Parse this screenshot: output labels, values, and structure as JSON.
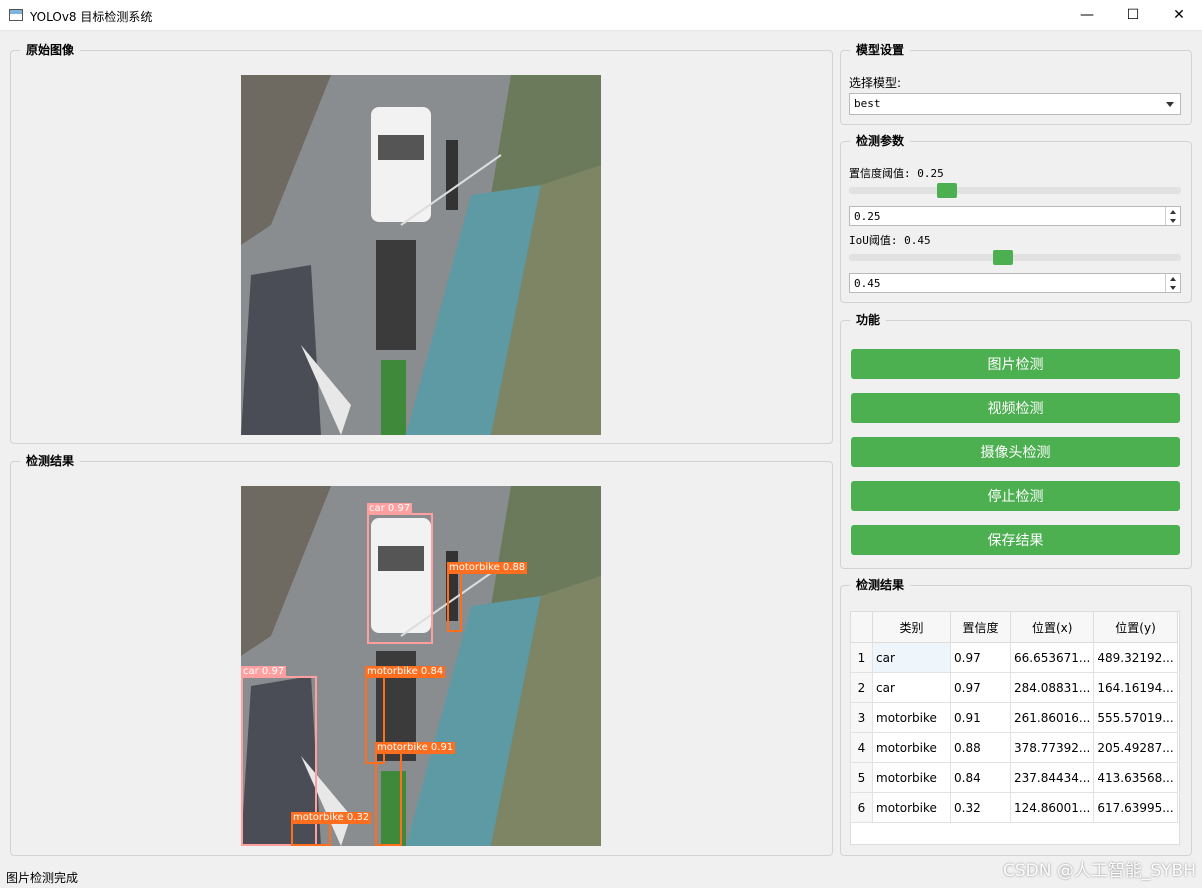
{
  "window": {
    "title": "YOLOv8 目标检测系统",
    "minimize": "—",
    "maximize": "☐",
    "close": "✕"
  },
  "groups": {
    "original": "原始图像",
    "result": "检测结果",
    "model": "模型设置",
    "params": "检测参数",
    "functions": "功能",
    "results_table": "检测结果"
  },
  "model": {
    "label": "选择模型:",
    "selected": "best"
  },
  "params": {
    "conf_label": "置信度阈值: 0.25",
    "conf_value": "0.25",
    "conf_fraction": 0.25,
    "iou_label": "IoU阈值: 0.45",
    "iou_value": "0.45",
    "iou_fraction": 0.45
  },
  "buttons": {
    "image": "图片检测",
    "video": "视频检测",
    "camera": "摄像头检测",
    "stop": "停止检测",
    "save": "保存结果"
  },
  "table": {
    "headers": [
      "类别",
      "置信度",
      "位置(x)",
      "位置(y)"
    ],
    "rows": [
      {
        "n": "1",
        "cls": "car",
        "conf": "0.97",
        "x": "66.653671...",
        "y": "489.32192..."
      },
      {
        "n": "2",
        "cls": "car",
        "conf": "0.97",
        "x": "284.08831...",
        "y": "164.16194..."
      },
      {
        "n": "3",
        "cls": "motorbike",
        "conf": "0.91",
        "x": "261.86016...",
        "y": "555.57019..."
      },
      {
        "n": "4",
        "cls": "motorbike",
        "conf": "0.88",
        "x": "378.77392...",
        "y": "205.49287..."
      },
      {
        "n": "5",
        "cls": "motorbike",
        "conf": "0.84",
        "x": "237.84434...",
        "y": "413.63568..."
      },
      {
        "n": "6",
        "cls": "motorbike",
        "conf": "0.32",
        "x": "124.86001...",
        "y": "617.63995..."
      }
    ]
  },
  "detections": [
    {
      "label": "car 0.97"
    },
    {
      "label": "motorbike 0.88"
    },
    {
      "label": "car 0.97"
    },
    {
      "label": "motorbike 0.84"
    },
    {
      "label": "motorbike 0.91"
    },
    {
      "label": "motorbike 0.32"
    }
  ],
  "status": "图片检测完成",
  "watermark": "CSDN @人工智能_SYBH",
  "colors": {
    "accent": "#4caf50",
    "car_box": "#ff9f9f",
    "motorbike_box": "#ff6d1f"
  }
}
